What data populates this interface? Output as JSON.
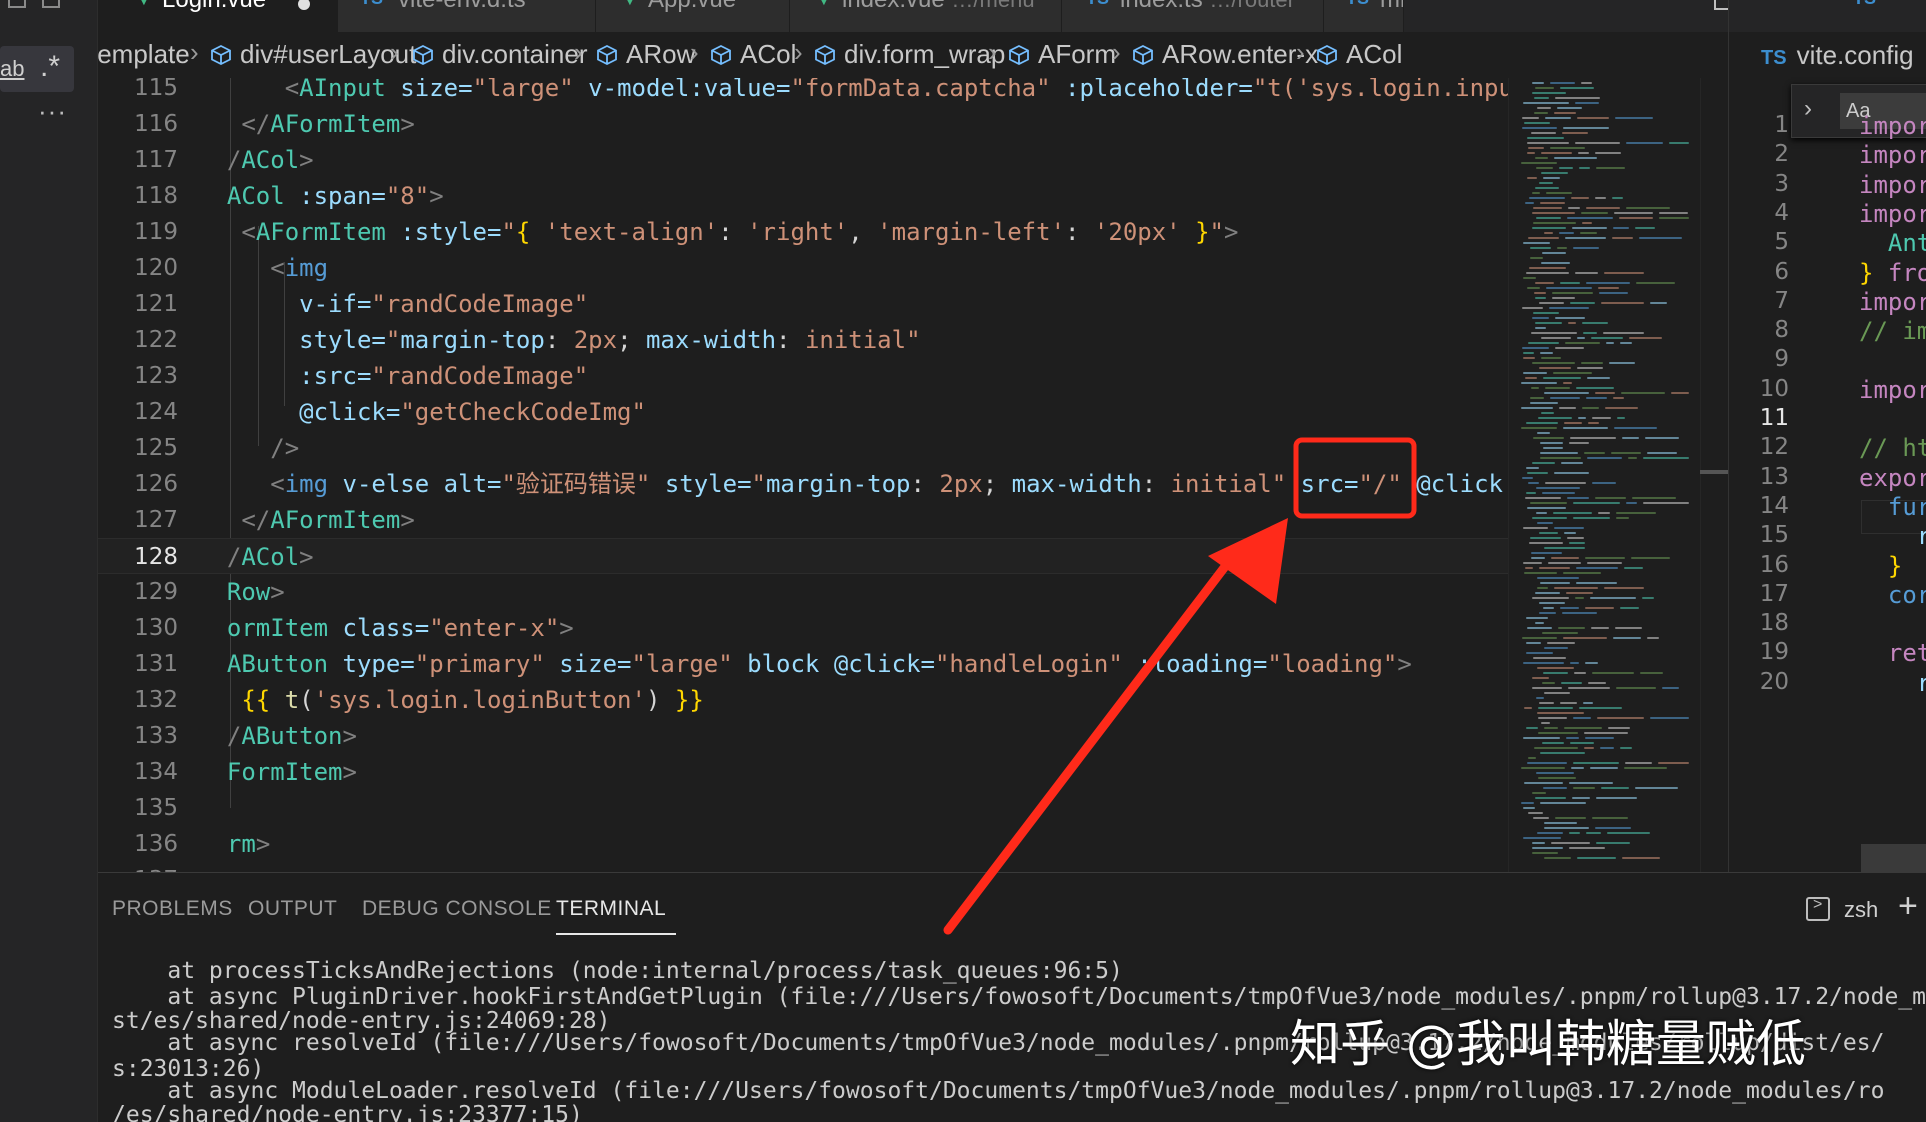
{
  "left_strip": {
    "chip_label_1": "ab",
    "chip_label_2": ".*",
    "more_label": "···"
  },
  "tabs": [
    {
      "icon": "vue",
      "label": "Login.vue",
      "sub": "",
      "dirty": true,
      "active": true
    },
    {
      "icon": "ts",
      "label": "vite-env.d.ts",
      "sub": "",
      "active": false
    },
    {
      "icon": "vue",
      "label": "App.vue",
      "sub": "",
      "active": false
    },
    {
      "icon": "vue",
      "label": "index.vue",
      "sub": "…/menu",
      "active": false
    },
    {
      "icon": "ts",
      "label": "index.ts",
      "sub": "…/router",
      "active": false
    },
    {
      "icon": "ts",
      "label": "mi",
      "sub": "",
      "active": false
    }
  ],
  "breadcrumb": [
    {
      "label": "template",
      "icon": false
    },
    {
      "label": "div#userLayout",
      "icon": true
    },
    {
      "label": "div.container",
      "icon": true
    },
    {
      "label": "ARow",
      "icon": true
    },
    {
      "label": "ACol",
      "icon": true
    },
    {
      "label": "div.form_wrap",
      "icon": true
    },
    {
      "label": "AForm",
      "icon": true
    },
    {
      "label": "ARow.enter-x",
      "icon": true
    },
    {
      "label": "ACol",
      "icon": true
    }
  ],
  "editor": {
    "current_line": 128,
    "lines": [
      {
        "n": "115",
        "indent": "      ",
        "tokens": [
          [
            "punc",
            "<"
          ],
          [
            "comp",
            "AInput"
          ],
          [
            "attr",
            " size="
          ],
          [
            "str",
            "\"large\""
          ],
          [
            "attr",
            " v-model:value="
          ],
          [
            "str",
            "\"formData.captcha\""
          ],
          [
            "attr",
            " :placeholder="
          ],
          [
            "str",
            "\"t('sys.login.inpu"
          ]
        ]
      },
      {
        "n": "116",
        "indent": "   ",
        "tokens": [
          [
            "punc",
            "</"
          ],
          [
            "comp",
            "AFormItem"
          ],
          [
            "punc",
            ">"
          ]
        ]
      },
      {
        "n": "117",
        "indent": "  ",
        "tokens": [
          [
            "punc",
            "/"
          ],
          [
            "comp",
            "ACol"
          ],
          [
            "punc",
            ">"
          ]
        ]
      },
      {
        "n": "118",
        "indent": "  ",
        "tokens": [
          [
            "comp",
            "ACol"
          ],
          [
            "attr",
            " :span="
          ],
          [
            "str",
            "\"8\""
          ],
          [
            "punc",
            ">"
          ]
        ]
      },
      {
        "n": "119",
        "indent": "   ",
        "tokens": [
          [
            "punc",
            "<"
          ],
          [
            "comp",
            "AFormItem"
          ],
          [
            "attr",
            " :style="
          ],
          [
            "str",
            "\""
          ],
          [
            "brace",
            "{"
          ],
          [
            "str",
            " 'text-align'"
          ],
          [
            "plain",
            ": "
          ],
          [
            "str",
            "'right'"
          ],
          [
            "plain",
            ", "
          ],
          [
            "str",
            "'margin-left'"
          ],
          [
            "plain",
            ": "
          ],
          [
            "str",
            "'20px'"
          ],
          [
            "brace",
            " }"
          ],
          [
            "str",
            "\""
          ],
          [
            "punc",
            ">"
          ]
        ]
      },
      {
        "n": "120",
        "indent": "     ",
        "tokens": [
          [
            "punc",
            "<"
          ],
          [
            "tag",
            "img"
          ]
        ]
      },
      {
        "n": "121",
        "indent": "       ",
        "tokens": [
          [
            "attr",
            "v-if="
          ],
          [
            "str",
            "\"randCodeImage\""
          ]
        ]
      },
      {
        "n": "122",
        "indent": "       ",
        "tokens": [
          [
            "attr",
            "style="
          ],
          [
            "str",
            "\""
          ],
          [
            "attr",
            "margin-top"
          ],
          [
            "plain",
            ": "
          ],
          [
            "str",
            "2px"
          ],
          [
            "plain",
            "; "
          ],
          [
            "attr",
            "max-width"
          ],
          [
            "plain",
            ": "
          ],
          [
            "str",
            "initial"
          ],
          [
            "str",
            "\""
          ]
        ]
      },
      {
        "n": "123",
        "indent": "       ",
        "tokens": [
          [
            "attr",
            ":src="
          ],
          [
            "str",
            "\"randCodeImage\""
          ]
        ]
      },
      {
        "n": "124",
        "indent": "       ",
        "tokens": [
          [
            "attr",
            "@click="
          ],
          [
            "str",
            "\"getCheckCodeImg\""
          ]
        ]
      },
      {
        "n": "125",
        "indent": "     ",
        "tokens": [
          [
            "punc",
            "/>"
          ]
        ]
      },
      {
        "n": "126",
        "indent": "     ",
        "tokens": [
          [
            "punc",
            "<"
          ],
          [
            "tag",
            "img"
          ],
          [
            "attr",
            " v-else"
          ],
          [
            "attr",
            " alt="
          ],
          [
            "str",
            "\"验证码错误\""
          ],
          [
            "attr",
            " style="
          ],
          [
            "str",
            "\""
          ],
          [
            "attr",
            "margin-top"
          ],
          [
            "plain",
            ": "
          ],
          [
            "str",
            "2px"
          ],
          [
            "plain",
            "; "
          ],
          [
            "attr",
            "max-width"
          ],
          [
            "plain",
            ": "
          ],
          [
            "str",
            "initial"
          ],
          [
            "str",
            "\""
          ],
          [
            "attr",
            " src="
          ],
          [
            "str",
            "\"/\""
          ],
          [
            "attr",
            " @click"
          ]
        ]
      },
      {
        "n": "127",
        "indent": "   ",
        "tokens": [
          [
            "punc",
            "</"
          ],
          [
            "comp",
            "AFormItem"
          ],
          [
            "punc",
            ">"
          ]
        ]
      },
      {
        "n": "128",
        "indent": "  ",
        "tokens": [
          [
            "punc",
            "/"
          ],
          [
            "comp",
            "ACol"
          ],
          [
            "punc",
            ">"
          ]
        ]
      },
      {
        "n": "129",
        "indent": "  ",
        "tokens": [
          [
            "comp",
            "Row"
          ],
          [
            "punc",
            ">"
          ]
        ]
      },
      {
        "n": "130",
        "indent": "  ",
        "tokens": [
          [
            "comp",
            "ormItem"
          ],
          [
            "attr",
            " class="
          ],
          [
            "str",
            "\"enter-x\""
          ],
          [
            "punc",
            ">"
          ]
        ]
      },
      {
        "n": "131",
        "indent": "  ",
        "tokens": [
          [
            "comp",
            "AButton"
          ],
          [
            "attr",
            " type="
          ],
          [
            "str",
            "\"primary\""
          ],
          [
            "attr",
            " size="
          ],
          [
            "str",
            "\"large\""
          ],
          [
            "attr",
            " block"
          ],
          [
            "attr",
            " @click="
          ],
          [
            "str",
            "\"handleLogin\""
          ],
          [
            "attr",
            " :loading="
          ],
          [
            "str",
            "\"loading\""
          ],
          [
            "punc",
            ">"
          ]
        ]
      },
      {
        "n": "132",
        "indent": "   ",
        "tokens": [
          [
            "brace",
            "{{ "
          ],
          [
            "fn",
            "t"
          ],
          [
            "plain",
            "("
          ],
          [
            "str",
            "'sys.login.loginButton'"
          ],
          [
            "plain",
            ")"
          ],
          [
            "brace",
            " }}"
          ]
        ]
      },
      {
        "n": "133",
        "indent": "  ",
        "tokens": [
          [
            "punc",
            "/"
          ],
          [
            "comp",
            "AButton"
          ],
          [
            "punc",
            ">"
          ]
        ]
      },
      {
        "n": "134",
        "indent": "  ",
        "tokens": [
          [
            "comp",
            "FormItem"
          ],
          [
            "punc",
            ">"
          ]
        ]
      },
      {
        "n": "135",
        "indent": "",
        "tokens": []
      },
      {
        "n": "136",
        "indent": "  ",
        "tokens": [
          [
            "comp",
            "rm"
          ],
          [
            "punc",
            ">"
          ]
        ]
      },
      {
        "n": "137",
        "indent": "",
        "tokens": []
      }
    ]
  },
  "right_pane": {
    "tab_icon": "TS",
    "breadcrumb_icon": "TS",
    "breadcrumb_label": "vite.config",
    "find_value": "Aa",
    "lines": [
      {
        "n": "1",
        "tokens": [
          [
            "kw",
            "impor"
          ]
        ]
      },
      {
        "n": "2",
        "tokens": [
          [
            "kw",
            "impor"
          ]
        ]
      },
      {
        "n": "3",
        "tokens": [
          [
            "kw",
            "impor"
          ]
        ]
      },
      {
        "n": "4",
        "tokens": [
          [
            "kw",
            "impor"
          ]
        ]
      },
      {
        "n": "5",
        "tokens": [
          [
            "cls",
            "  Ant"
          ]
        ]
      },
      {
        "n": "6",
        "tokens": [
          [
            "brace",
            "} "
          ],
          [
            "kw",
            "fro"
          ]
        ]
      },
      {
        "n": "7",
        "tokens": [
          [
            "kw",
            "impor"
          ]
        ]
      },
      {
        "n": "8",
        "tokens": [
          [
            "cm",
            "// im"
          ]
        ]
      },
      {
        "n": "9",
        "tokens": []
      },
      {
        "n": "10",
        "tokens": [
          [
            "kw",
            "impor"
          ]
        ]
      },
      {
        "n": "11",
        "tokens": []
      },
      {
        "n": "12",
        "tokens": [
          [
            "cm",
            "// ht"
          ]
        ]
      },
      {
        "n": "13",
        "tokens": [
          [
            "kw",
            "expor"
          ]
        ]
      },
      {
        "n": "14",
        "tokens": [
          [
            "fn",
            "  fur"
          ]
        ]
      },
      {
        "n": "15",
        "tokens": [
          [
            "var",
            "    r"
          ]
        ]
      },
      {
        "n": "16",
        "tokens": [
          [
            "brace",
            "  }"
          ]
        ]
      },
      {
        "n": "17",
        "tokens": [
          [
            "fn",
            "  cor"
          ]
        ]
      },
      {
        "n": "18",
        "tokens": []
      },
      {
        "n": "19",
        "tokens": [
          [
            "kw",
            "  ret"
          ]
        ]
      },
      {
        "n": "20",
        "tokens": [
          [
            "var",
            "    r"
          ]
        ]
      }
    ],
    "current_line": "11"
  },
  "panel": {
    "tabs": [
      "PROBLEMS",
      "OUTPUT",
      "DEBUG CONSOLE",
      "TERMINAL"
    ],
    "active_tab": "TERMINAL",
    "shell": "zsh",
    "add_label": "+",
    "terminal_lines": [
      "    at processTicksAndRejections (node:internal/process/task_queues:96:5)",
      "    at async PluginDriver.hookFirstAndGetPlugin (file:///Users/fowosoft/Documents/tmpOfVue3/node_modules/.pnpm/rollup@3.17.2/node_mod",
      "st/es/shared/node-entry.js:24069:28)",
      "    at async resolveId (file:///Users/fowosoft/Documents/tmpOfVue3/node_modules/.pnpm/rollup@3.17.2/node_modules/rollup/dist/es/",
      "s:23013:26)",
      "    at async ModuleLoader.resolveId (file:///Users/fowosoft/Documents/tmpOfVue3/node_modules/.pnpm/rollup@3.17.2/node_modules/ro",
      "/es/shared/node-entry.js:23377:15)"
    ]
  },
  "annotation": {
    "color": "#ff2a1a"
  },
  "watermark": "知乎 @我叫韩糖量贼低",
  "colors": {
    "editor_bg": "#1e1e1e",
    "tag": "#569cd6",
    "component": "#4ec9b0",
    "attribute": "#9cdcfe",
    "string": "#ce9178",
    "brace": "#ffd700",
    "vue_icon": "#41b883",
    "ts_icon": "#3c8ecf"
  }
}
